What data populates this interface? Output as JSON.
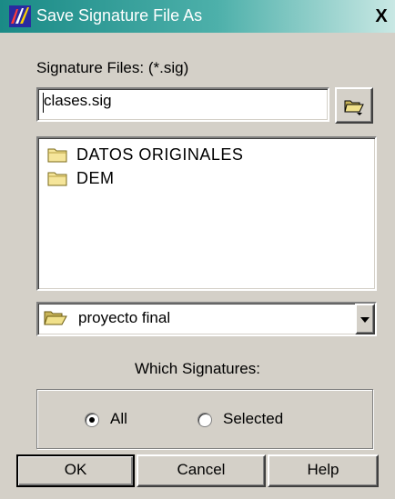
{
  "window": {
    "title": "Save Signature File As",
    "close_label": "X"
  },
  "file_filter_label": "Signature Files: (*.sig)",
  "filename_input": {
    "value": "clases.sig"
  },
  "folders": [
    {
      "name": "DATOS ORIGINALES",
      "icon": "folder-icon"
    },
    {
      "name": "DEM",
      "icon": "folder-icon"
    }
  ],
  "directory_select": {
    "value": "proyecto final",
    "icon": "open-folder-icon"
  },
  "which_signatures": {
    "label": "Which Signatures:",
    "options": [
      {
        "label": "All",
        "selected": true
      },
      {
        "label": "Selected",
        "selected": false
      }
    ]
  },
  "buttons": {
    "ok": "OK",
    "cancel": "Cancel",
    "help": "Help"
  }
}
